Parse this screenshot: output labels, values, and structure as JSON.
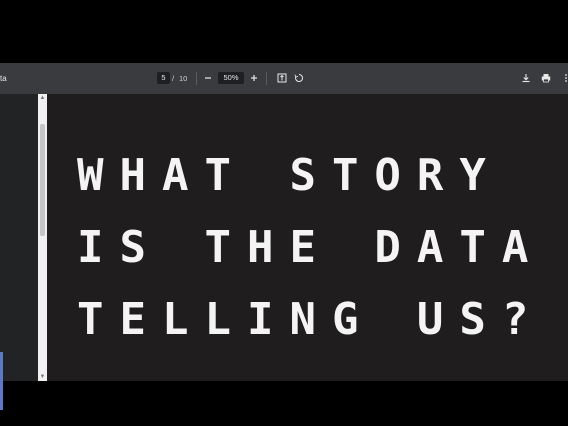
{
  "toolbar": {
    "doc_title": "ta",
    "page_current": "5",
    "page_separator": "/",
    "page_total": "10",
    "zoom": "50%",
    "icons": [
      "zoom-out-icon",
      "zoom-in-icon",
      "fit-page-icon",
      "rotate-icon",
      "download-icon",
      "print-icon",
      "more-options-icon"
    ]
  },
  "page": {
    "headline_lines": [
      "WHAT STORY",
      "IS THE DATA",
      "TELLING US?"
    ]
  },
  "colors": {
    "toolbar_bg": "#3a3b3e",
    "page_bg": "#1f1d1d",
    "text": "#f4f4f4",
    "sidebar_accent": "#5b79c9"
  }
}
